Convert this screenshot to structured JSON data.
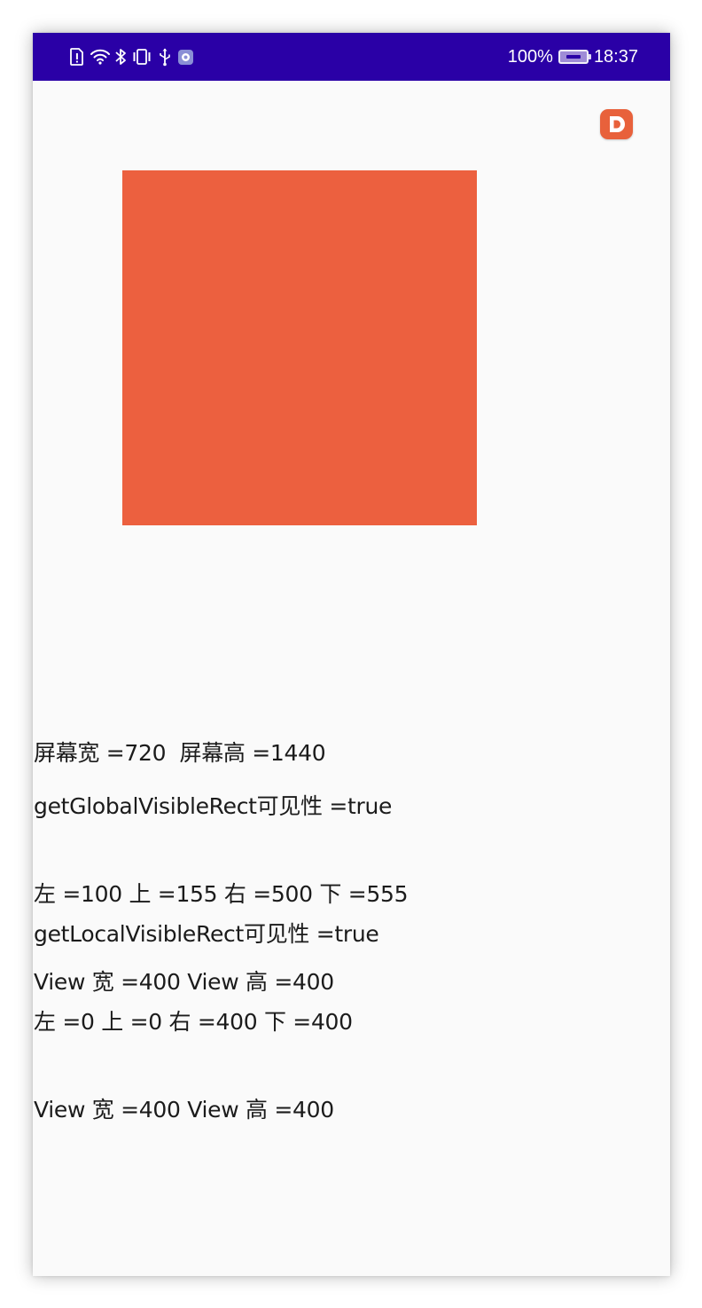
{
  "status_bar": {
    "battery_percent": "100%",
    "time": "18:37",
    "background_color": "#2a00a6",
    "left_icons": [
      "sim-alert-icon",
      "wifi-icon",
      "bluetooth-icon",
      "vibrate-icon",
      "usb-icon",
      "app-notification-icon"
    ]
  },
  "app_badge": {
    "icon": "d-logo-icon",
    "color": "#e8613b"
  },
  "view": {
    "color": "#ec603f"
  },
  "screen_info": {
    "line": "屏幕宽 =720  屏幕高 =1440"
  },
  "global_rect": {
    "line1": "getGlobalVisibleRect可见性 =true",
    "line2": "左 =100 上 =155 右 =500 下 =555",
    "line3": "View 宽 =400 View 高 =400"
  },
  "local_rect": {
    "line1": "getLocalVisibleRect可见性 =true",
    "line2": "左 =0 上 =0 右 =400 下 =400",
    "line3": "View 宽 =400 View 高 =400"
  }
}
